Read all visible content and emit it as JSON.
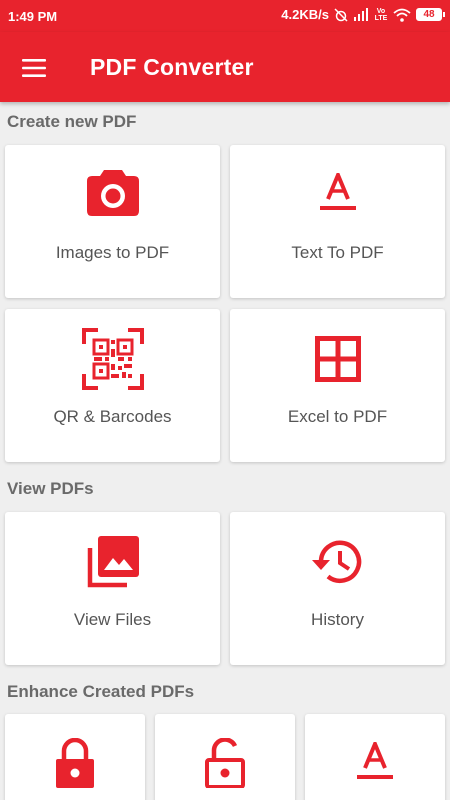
{
  "status_bar": {
    "time": "1:49 PM",
    "network_speed": "4.2KB/s",
    "volte": "Vo LTE",
    "battery": "48"
  },
  "app_bar": {
    "title": "PDF Converter",
    "menu_icon": "hamburger-menu-icon"
  },
  "colors": {
    "primary": "#e8232d",
    "background": "#efefef",
    "card": "#ffffff",
    "section_text": "#6a6a6a",
    "card_text": "#555555"
  },
  "sections": {
    "create": {
      "title": "Create new PDF",
      "items": [
        {
          "label": "Images to PDF",
          "icon": "camera-icon"
        },
        {
          "label": "Text To PDF",
          "icon": "text-format-icon"
        },
        {
          "label": "QR & Barcodes",
          "icon": "qr-code-scan-icon"
        },
        {
          "label": "Excel to PDF",
          "icon": "grid-table-icon"
        }
      ]
    },
    "view": {
      "title": "View PDFs",
      "items": [
        {
          "label": "View Files",
          "icon": "image-collection-icon"
        },
        {
          "label": "History",
          "icon": "history-icon"
        }
      ]
    },
    "enhance": {
      "title": "Enhance Created PDFs",
      "items": [
        {
          "label": "",
          "icon": "lock-icon"
        },
        {
          "label": "",
          "icon": "unlock-icon"
        },
        {
          "label": "",
          "icon": "text-format-icon"
        }
      ]
    }
  }
}
